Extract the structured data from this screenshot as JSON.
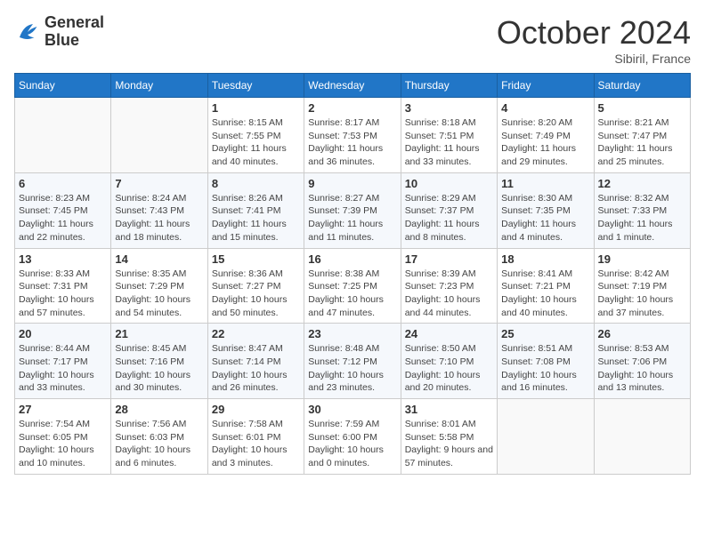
{
  "logo": {
    "line1": "General",
    "line2": "Blue"
  },
  "title": "October 2024",
  "location": "Sibiril, France",
  "weekdays": [
    "Sunday",
    "Monday",
    "Tuesday",
    "Wednesday",
    "Thursday",
    "Friday",
    "Saturday"
  ],
  "weeks": [
    [
      {
        "day": null
      },
      {
        "day": null
      },
      {
        "day": "1",
        "sunrise": "Sunrise: 8:15 AM",
        "sunset": "Sunset: 7:55 PM",
        "daylight": "Daylight: 11 hours and 40 minutes."
      },
      {
        "day": "2",
        "sunrise": "Sunrise: 8:17 AM",
        "sunset": "Sunset: 7:53 PM",
        "daylight": "Daylight: 11 hours and 36 minutes."
      },
      {
        "day": "3",
        "sunrise": "Sunrise: 8:18 AM",
        "sunset": "Sunset: 7:51 PM",
        "daylight": "Daylight: 11 hours and 33 minutes."
      },
      {
        "day": "4",
        "sunrise": "Sunrise: 8:20 AM",
        "sunset": "Sunset: 7:49 PM",
        "daylight": "Daylight: 11 hours and 29 minutes."
      },
      {
        "day": "5",
        "sunrise": "Sunrise: 8:21 AM",
        "sunset": "Sunset: 7:47 PM",
        "daylight": "Daylight: 11 hours and 25 minutes."
      }
    ],
    [
      {
        "day": "6",
        "sunrise": "Sunrise: 8:23 AM",
        "sunset": "Sunset: 7:45 PM",
        "daylight": "Daylight: 11 hours and 22 minutes."
      },
      {
        "day": "7",
        "sunrise": "Sunrise: 8:24 AM",
        "sunset": "Sunset: 7:43 PM",
        "daylight": "Daylight: 11 hours and 18 minutes."
      },
      {
        "day": "8",
        "sunrise": "Sunrise: 8:26 AM",
        "sunset": "Sunset: 7:41 PM",
        "daylight": "Daylight: 11 hours and 15 minutes."
      },
      {
        "day": "9",
        "sunrise": "Sunrise: 8:27 AM",
        "sunset": "Sunset: 7:39 PM",
        "daylight": "Daylight: 11 hours and 11 minutes."
      },
      {
        "day": "10",
        "sunrise": "Sunrise: 8:29 AM",
        "sunset": "Sunset: 7:37 PM",
        "daylight": "Daylight: 11 hours and 8 minutes."
      },
      {
        "day": "11",
        "sunrise": "Sunrise: 8:30 AM",
        "sunset": "Sunset: 7:35 PM",
        "daylight": "Daylight: 11 hours and 4 minutes."
      },
      {
        "day": "12",
        "sunrise": "Sunrise: 8:32 AM",
        "sunset": "Sunset: 7:33 PM",
        "daylight": "Daylight: 11 hours and 1 minute."
      }
    ],
    [
      {
        "day": "13",
        "sunrise": "Sunrise: 8:33 AM",
        "sunset": "Sunset: 7:31 PM",
        "daylight": "Daylight: 10 hours and 57 minutes."
      },
      {
        "day": "14",
        "sunrise": "Sunrise: 8:35 AM",
        "sunset": "Sunset: 7:29 PM",
        "daylight": "Daylight: 10 hours and 54 minutes."
      },
      {
        "day": "15",
        "sunrise": "Sunrise: 8:36 AM",
        "sunset": "Sunset: 7:27 PM",
        "daylight": "Daylight: 10 hours and 50 minutes."
      },
      {
        "day": "16",
        "sunrise": "Sunrise: 8:38 AM",
        "sunset": "Sunset: 7:25 PM",
        "daylight": "Daylight: 10 hours and 47 minutes."
      },
      {
        "day": "17",
        "sunrise": "Sunrise: 8:39 AM",
        "sunset": "Sunset: 7:23 PM",
        "daylight": "Daylight: 10 hours and 44 minutes."
      },
      {
        "day": "18",
        "sunrise": "Sunrise: 8:41 AM",
        "sunset": "Sunset: 7:21 PM",
        "daylight": "Daylight: 10 hours and 40 minutes."
      },
      {
        "day": "19",
        "sunrise": "Sunrise: 8:42 AM",
        "sunset": "Sunset: 7:19 PM",
        "daylight": "Daylight: 10 hours and 37 minutes."
      }
    ],
    [
      {
        "day": "20",
        "sunrise": "Sunrise: 8:44 AM",
        "sunset": "Sunset: 7:17 PM",
        "daylight": "Daylight: 10 hours and 33 minutes."
      },
      {
        "day": "21",
        "sunrise": "Sunrise: 8:45 AM",
        "sunset": "Sunset: 7:16 PM",
        "daylight": "Daylight: 10 hours and 30 minutes."
      },
      {
        "day": "22",
        "sunrise": "Sunrise: 8:47 AM",
        "sunset": "Sunset: 7:14 PM",
        "daylight": "Daylight: 10 hours and 26 minutes."
      },
      {
        "day": "23",
        "sunrise": "Sunrise: 8:48 AM",
        "sunset": "Sunset: 7:12 PM",
        "daylight": "Daylight: 10 hours and 23 minutes."
      },
      {
        "day": "24",
        "sunrise": "Sunrise: 8:50 AM",
        "sunset": "Sunset: 7:10 PM",
        "daylight": "Daylight: 10 hours and 20 minutes."
      },
      {
        "day": "25",
        "sunrise": "Sunrise: 8:51 AM",
        "sunset": "Sunset: 7:08 PM",
        "daylight": "Daylight: 10 hours and 16 minutes."
      },
      {
        "day": "26",
        "sunrise": "Sunrise: 8:53 AM",
        "sunset": "Sunset: 7:06 PM",
        "daylight": "Daylight: 10 hours and 13 minutes."
      }
    ],
    [
      {
        "day": "27",
        "sunrise": "Sunrise: 7:54 AM",
        "sunset": "Sunset: 6:05 PM",
        "daylight": "Daylight: 10 hours and 10 minutes."
      },
      {
        "day": "28",
        "sunrise": "Sunrise: 7:56 AM",
        "sunset": "Sunset: 6:03 PM",
        "daylight": "Daylight: 10 hours and 6 minutes."
      },
      {
        "day": "29",
        "sunrise": "Sunrise: 7:58 AM",
        "sunset": "Sunset: 6:01 PM",
        "daylight": "Daylight: 10 hours and 3 minutes."
      },
      {
        "day": "30",
        "sunrise": "Sunrise: 7:59 AM",
        "sunset": "Sunset: 6:00 PM",
        "daylight": "Daylight: 10 hours and 0 minutes."
      },
      {
        "day": "31",
        "sunrise": "Sunrise: 8:01 AM",
        "sunset": "Sunset: 5:58 PM",
        "daylight": "Daylight: 9 hours and 57 minutes."
      },
      {
        "day": null
      },
      {
        "day": null
      }
    ]
  ]
}
